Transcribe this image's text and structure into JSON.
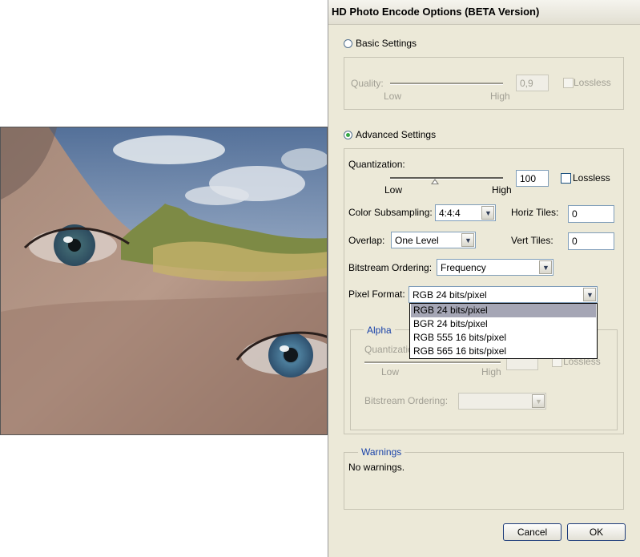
{
  "dialog": {
    "title": "HD Photo Encode Options (BETA Version)",
    "cancel_label": "Cancel",
    "ok_label": "OK"
  },
  "basic": {
    "label": "Basic Settings",
    "selected": false,
    "quality_label": "Quality:",
    "quality_value": "0,9",
    "low_label": "Low",
    "high_label": "High",
    "lossless_label": "Lossless"
  },
  "advanced": {
    "label": "Advanced Settings",
    "selected": true,
    "quantization_label": "Quantization:",
    "quantization_value": "100",
    "low_label": "Low",
    "high_label": "High",
    "lossless_label": "Lossless",
    "color_subsampling_label": "Color Subsampling:",
    "color_subsampling_value": "4:4:4",
    "horiz_tiles_label": "Horiz Tiles:",
    "horiz_tiles_value": "0",
    "overlap_label": "Overlap:",
    "overlap_value": "One Level",
    "vert_tiles_label": "Vert Tiles:",
    "vert_tiles_value": "0",
    "bitstream_label": "Bitstream Ordering:",
    "bitstream_value": "Frequency",
    "pixel_format_label": "Pixel Format:",
    "pixel_format_value": "RGB 24 bits/pixel",
    "pixel_format_options": [
      "RGB 24 bits/pixel",
      "BGR 24 bits/pixel",
      "RGB 555 16 bits/pixel",
      "RGB 565 16 bits/pixel"
    ]
  },
  "alpha": {
    "caption": "Alpha",
    "quantization_label": "Quantizatio",
    "low_label": "Low",
    "high_label": "High",
    "lossless_label": "Lossless",
    "bitstream_label": "Bitstream Ordering:"
  },
  "warnings": {
    "caption": "Warnings",
    "text": "No warnings."
  }
}
